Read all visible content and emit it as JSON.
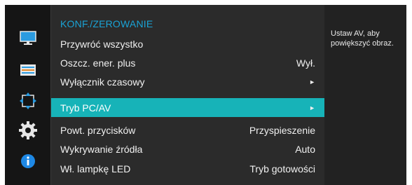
{
  "menu": {
    "title": "KONF./ZEROWANIE",
    "items": [
      {
        "label": "Przywróć wszystko",
        "value": "",
        "arrow": false,
        "selected": false
      },
      {
        "label": "Oszcz. ener. plus",
        "value": "Wył.",
        "arrow": false,
        "selected": false
      },
      {
        "label": "Wyłącznik czasowy",
        "value": "",
        "arrow": true,
        "selected": false
      },
      {
        "label": "Tryb PC/AV",
        "value": "",
        "arrow": true,
        "selected": true
      },
      {
        "label": "Powt. przycisków",
        "value": "Przyspieszenie",
        "arrow": false,
        "selected": false
      },
      {
        "label": "Wykrywanie źródła",
        "value": "Auto",
        "arrow": false,
        "selected": false
      },
      {
        "label": "Wł. lampkę LED",
        "value": "Tryb gotowości",
        "arrow": false,
        "selected": false
      }
    ],
    "arrow_glyph": "►"
  },
  "help": {
    "text": "Ustaw AV, aby powiększyć obraz."
  },
  "icons": [
    "picture-icon",
    "onscreen-display-icon",
    "setup-reset-icon",
    "system-gear-icon",
    "information-icon"
  ],
  "colors": {
    "accent_title": "#1aa3d6",
    "selected_row": "#17b3b8",
    "info_blue": "#1e88e5"
  }
}
